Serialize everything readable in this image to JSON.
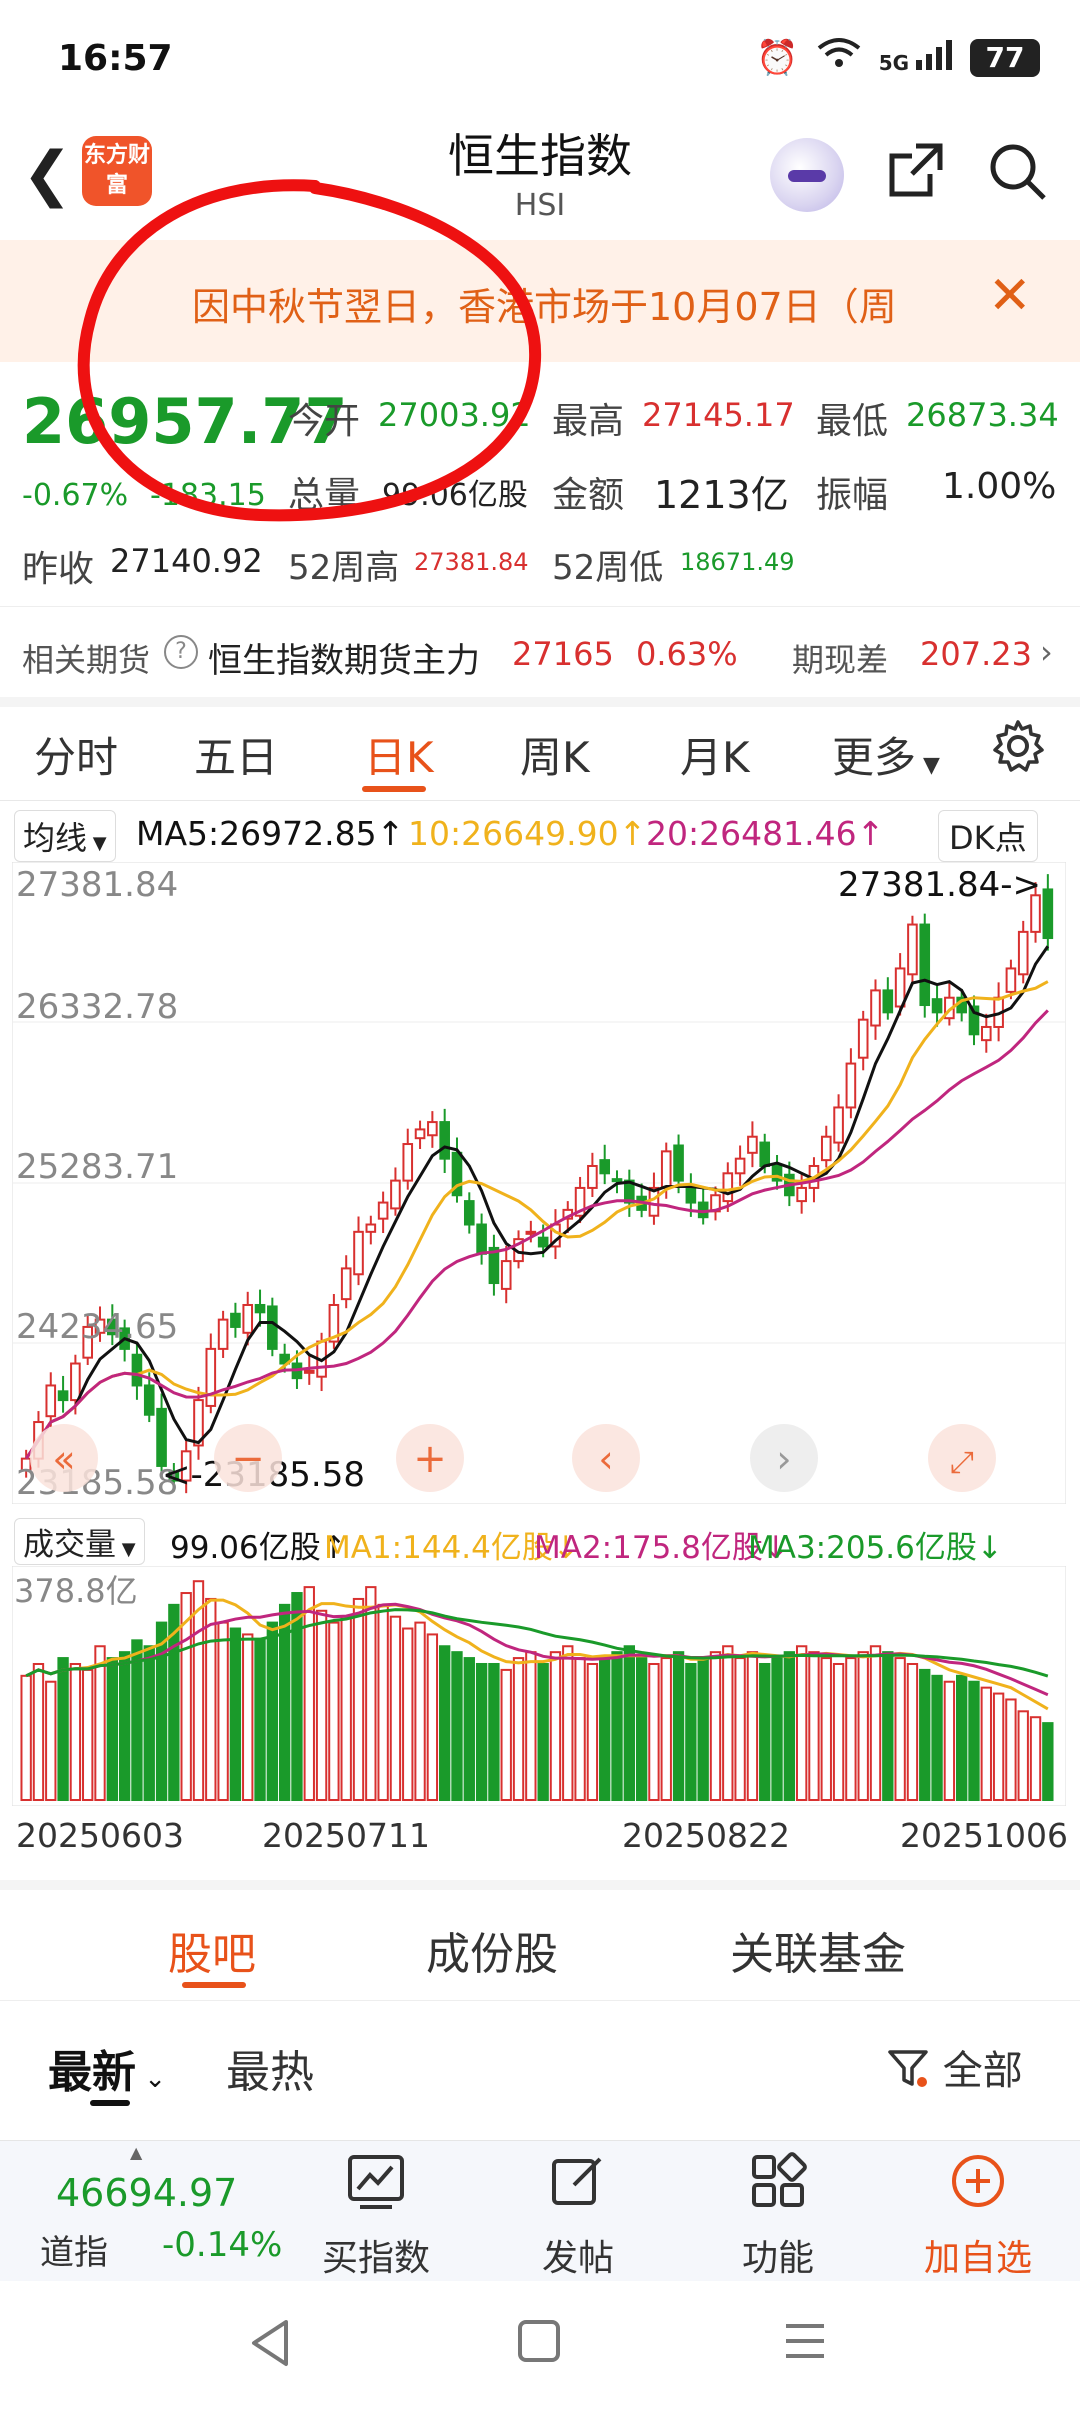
{
  "status_bar": {
    "time": "16:57",
    "network": "5G",
    "battery": "77"
  },
  "header": {
    "logo_text": "东方财富",
    "title": "恒生指数",
    "subtitle": "HSI"
  },
  "notice": {
    "text": "因中秋节翌日，香港市场于10月07日（周"
  },
  "quote": {
    "price": "26957.77",
    "change_pct": "-0.67%",
    "change": "-183.15",
    "open_label": "今开",
    "open": "27003.92",
    "high_label": "最高",
    "high": "27145.17",
    "low_label": "最低",
    "low": "26873.34",
    "volume_label": "总量",
    "volume": "99.06亿股",
    "amount_label": "金额",
    "amount": "1213亿",
    "amplitude_label": "振幅",
    "amplitude": "1.00%",
    "prev_close_label": "昨收",
    "prev_close": "27140.92",
    "w52_high_label": "52周高",
    "w52_high": "27381.84",
    "w52_low_label": "52周低",
    "w52_low": "18671.49"
  },
  "futures": {
    "label": "相关期货",
    "name": "恒生指数期货主力",
    "price": "27165",
    "pct": "0.63%",
    "basis_label": "期现差",
    "basis": "207.23"
  },
  "chart_tabs": [
    "分时",
    "五日",
    "日K",
    "周K",
    "月K",
    "更多"
  ],
  "ma_legend": {
    "selector": "均线",
    "ma5": "MA5:26972.85↑",
    "ma10": "10:26649.90↑",
    "ma20": "20:26481.46↑",
    "dk_button": "DK点"
  },
  "chart_data": {
    "type": "candlestick",
    "y_ticks": [
      "27381.84",
      "26332.78",
      "25283.71",
      "24234.65",
      "23185.58"
    ],
    "ylim": [
      23185.58,
      27381.84
    ],
    "max_label": "27381.84->",
    "min_label": "<-23185.58",
    "x_labels": [
      "20250603",
      "20250711",
      "20250822",
      "20251006"
    ],
    "closes": [
      23400,
      23650,
      23900,
      23800,
      24050,
      24300,
      24350,
      24250,
      24150,
      23900,
      23700,
      23350,
      23250,
      23450,
      23800,
      24150,
      24350,
      24300,
      24450,
      24400,
      24150,
      24050,
      23950,
      24000,
      24200,
      24450,
      24700,
      24950,
      25000,
      25150,
      25300,
      25550,
      25650,
      25700,
      25450,
      25200,
      25000,
      24800,
      24600,
      24750,
      24900,
      24950,
      24850,
      25000,
      25100,
      25250,
      25400,
      25350,
      25300,
      25150,
      25100,
      25250,
      25500,
      25300,
      25150,
      25050,
      25200,
      25350,
      25450,
      25600,
      25400,
      25300,
      25200,
      25250,
      25400,
      25600,
      25800,
      26100,
      26400,
      26600,
      26450,
      26750,
      27050,
      26500,
      26450,
      26550,
      26450,
      26300,
      26350,
      26550,
      26750,
      27000,
      27250,
      26957.77
    ],
    "volume": {
      "y_tick": "378.8亿",
      "values": [
        210,
        230,
        200,
        240,
        230,
        220,
        260,
        240,
        250,
        270,
        260,
        300,
        330,
        350,
        370,
        340,
        300,
        290,
        280,
        270,
        300,
        330,
        350,
        360,
        320,
        300,
        310,
        340,
        360,
        330,
        310,
        290,
        300,
        280,
        260,
        250,
        240,
        230,
        230,
        220,
        240,
        250,
        230,
        250,
        260,
        240,
        230,
        240,
        250,
        260,
        240,
        230,
        240,
        250,
        230,
        240,
        250,
        260,
        240,
        250,
        230,
        240,
        250,
        260,
        250,
        240,
        230,
        240,
        250,
        260,
        250,
        240,
        230,
        220,
        210,
        200,
        210,
        200,
        190,
        180,
        170,
        150,
        140,
        130
      ]
    }
  },
  "volume_legend": {
    "selector": "成交量",
    "vol": "99.06亿股↑",
    "ma1": "MA1:144.4亿股↓",
    "ma2": "MA2:175.8亿股↓",
    "ma3": "MA3:205.6亿股↓"
  },
  "section_tabs": [
    "股吧",
    "成份股",
    "关联基金"
  ],
  "sort": {
    "latest": "最新",
    "hot": "最热",
    "filter": "全部"
  },
  "toolbar": {
    "ticker_value": "46694.97",
    "ticker_name": "道指",
    "ticker_pct": "-0.14%",
    "buy_index": "买指数",
    "post": "发帖",
    "features": "功能",
    "add_watch": "加自选"
  },
  "colors": {
    "accent": "#e8521a",
    "up": "#d8302f",
    "down": "#1a9a2a",
    "ma5": "#111111",
    "ma10": "#f0b21c",
    "ma20": "#c0267e"
  }
}
